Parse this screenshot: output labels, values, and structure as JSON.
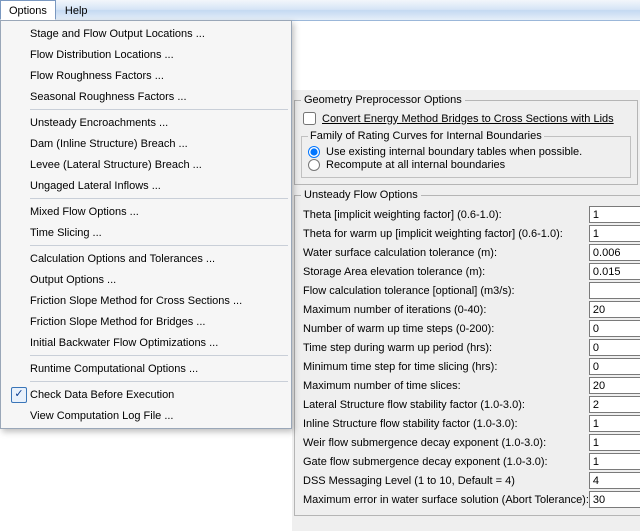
{
  "menubar": {
    "options": "Options",
    "help": "Help"
  },
  "menu": {
    "items": [
      "Stage and Flow Output Locations ...",
      "Flow Distribution Locations ...",
      "Flow Roughness Factors ...",
      "Seasonal Roughness Factors ..."
    ],
    "items2": [
      "Unsteady Encroachments ...",
      "Dam (Inline Structure) Breach ...",
      "Levee (Lateral Structure) Breach ...",
      "Ungaged Lateral Inflows ..."
    ],
    "items3": [
      "Mixed Flow Options ...",
      "Time Slicing ..."
    ],
    "items4": [
      "Calculation Options and Tolerances ...",
      "Output Options ...",
      "Friction Slope Method for Cross Sections ...",
      "Friction Slope Method for Bridges ...",
      "Initial Backwater Flow Optimizations ..."
    ],
    "items5": [
      "Runtime Computational Options ..."
    ],
    "items6": [
      "Check Data Before Execution",
      "View Computation Log File ..."
    ],
    "checked_index_in_items6": 0
  },
  "geom": {
    "legend": "Geometry Preprocessor Options",
    "convertLabel": "Convert Energy Method Bridges to Cross Sections with Lids",
    "famLegend": "Family of Rating Curves for Internal Boundaries",
    "famOpt1": "Use existing internal boundary tables when possible.",
    "famOpt2": "Recompute at all internal boundaries"
  },
  "unsteady": {
    "legend": "Unsteady Flow Options",
    "rows": [
      {
        "label": "Theta [implicit weighting factor] (0.6-1.0):",
        "value": "1"
      },
      {
        "label": "Theta for warm up [implicit weighting factor] (0.6-1.0):",
        "value": "1"
      },
      {
        "label": "Water surface calculation tolerance (m):",
        "value": "0.006"
      },
      {
        "label": "Storage Area elevation tolerance (m):",
        "value": "0.015"
      },
      {
        "label": "Flow calculation tolerance [optional] (m3/s):",
        "value": ""
      },
      {
        "label": "Maximum number of iterations (0-40):",
        "value": "20"
      },
      {
        "label": "Number of warm up time steps (0-200):",
        "value": "0"
      },
      {
        "label": "Time step during warm up period (hrs):",
        "value": "0"
      },
      {
        "label": "Minimum time step for time slicing (hrs):",
        "value": "0"
      },
      {
        "label": "Maximum number of time slices:",
        "value": "20"
      },
      {
        "label": "Lateral Structure flow stability factor (1.0-3.0):",
        "value": "2"
      },
      {
        "label": "Inline Structure flow stability factor (1.0-3.0):",
        "value": "1"
      },
      {
        "label": "Weir flow submergence decay exponent (1.0-3.0):",
        "value": "1"
      },
      {
        "label": "Gate flow submergence decay exponent (1.0-3.0):",
        "value": "1"
      },
      {
        "label": "DSS Messaging Level (1 to 10, Default = 4)",
        "value": "4"
      },
      {
        "label": "Maximum error in water surface solution (Abort Tolerance):",
        "value": "30"
      }
    ]
  }
}
